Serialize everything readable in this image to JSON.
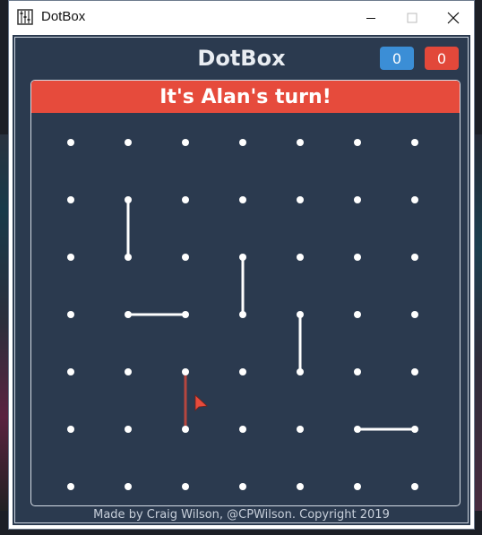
{
  "window": {
    "title": "DotBox",
    "icon": "abacus-app-icon"
  },
  "header": {
    "title": "DotBox",
    "score_blue": "0",
    "score_red": "0",
    "colors": {
      "blue": "#3b8ed6",
      "red": "#e2483a"
    }
  },
  "turn": {
    "text": "It's Alan's turn!",
    "color": "#e64b3c"
  },
  "board": {
    "cols": 7,
    "rows": 7,
    "dot_color": "#ffffff",
    "drawn_lines": [
      {
        "from": [
          1,
          1
        ],
        "to": [
          1,
          2
        ],
        "color": "#ffffff"
      },
      {
        "from": [
          3,
          2
        ],
        "to": [
          3,
          3
        ],
        "color": "#ffffff"
      },
      {
        "from": [
          1,
          3
        ],
        "to": [
          2,
          3
        ],
        "color": "#ffffff"
      },
      {
        "from": [
          4,
          3
        ],
        "to": [
          4,
          4
        ],
        "color": "#ffffff"
      },
      {
        "from": [
          5,
          5
        ],
        "to": [
          6,
          5
        ],
        "color": "#ffffff"
      }
    ],
    "hover_line": {
      "from": [
        2,
        4
      ],
      "to": [
        2,
        5
      ],
      "color": "#b5463f"
    },
    "cursor": "arrow-cursor-icon"
  },
  "footer": {
    "text": "Made by Craig Wilson, @CPWilson. Copyright 2019"
  }
}
